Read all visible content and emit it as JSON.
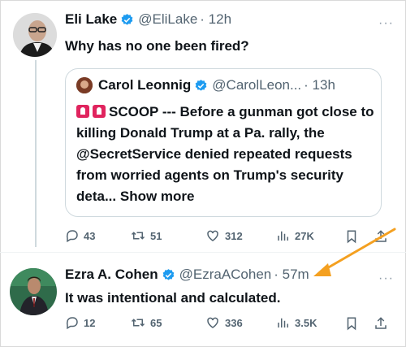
{
  "tweet1": {
    "name": "Eli Lake",
    "handle": "@EliLake",
    "time": "· 12h",
    "text": "Why has no one been fired?",
    "more": "···"
  },
  "quote": {
    "name": "Carol Leonnig",
    "handle": "@CarolLeon...",
    "time": "· 13h",
    "text_before": "SCOOP --- Before a gunman got close to killing Donald Trump at a Pa. rally, the @SecretService denied repeated requests from worried agents on Trump's  security deta...",
    "show_more": "Show more"
  },
  "tweet1_actions": {
    "replies": "43",
    "reposts": "51",
    "likes": "312",
    "views": "27K"
  },
  "tweet2": {
    "name": "Ezra A. Cohen",
    "handle": "@EzraACohen",
    "time": "· 57m",
    "text": "It was intentional and calculated.",
    "more": "···"
  },
  "tweet2_actions": {
    "replies": "12",
    "reposts": "65",
    "likes": "336",
    "views": "3.5K"
  },
  "colors": {
    "verified": "#1d9bf0",
    "arrow": "#f4a020",
    "secondary": "#536471"
  },
  "icons": [
    "reply-icon",
    "repost-icon",
    "like-icon",
    "views-icon",
    "bookmark-icon",
    "share-icon",
    "verified-icon",
    "siren-icon"
  ]
}
